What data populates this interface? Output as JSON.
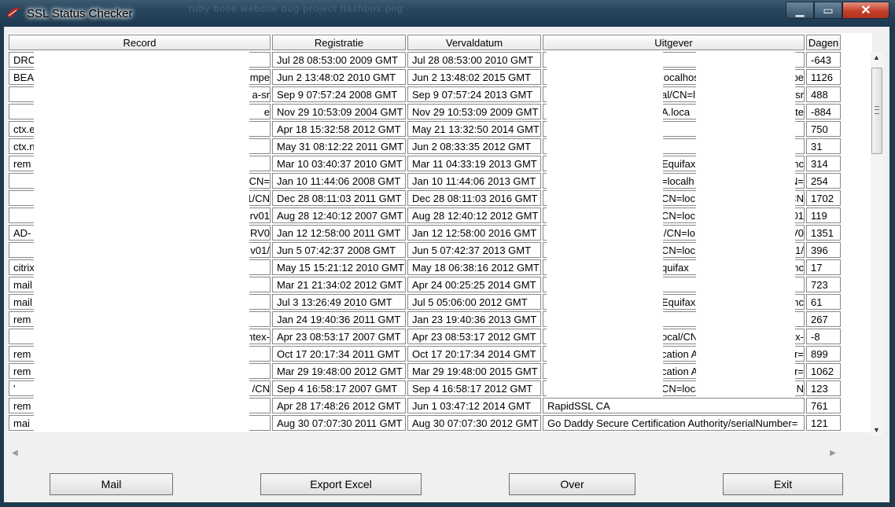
{
  "window": {
    "title": "SSL Status Checker",
    "app_icon": "tk-feather-icon",
    "background_taskbar": "ruby book    website    bug project    flashbox.png"
  },
  "columns": [
    "Record",
    "Registratie",
    "Vervaldatum",
    "Uitgever",
    "Dagen"
  ],
  "rows": [
    {
      "record_left": "DRC",
      "record_right": "",
      "registratie": "Jul 28 08:53:00 2009 GMT",
      "vervaldatum": "Jul 28 08:53:00 2010 GMT",
      "uitgever_left": "",
      "uitgever_mid": "",
      "uitgever_right": "",
      "dagen": "-643"
    },
    {
      "record_left": "BEA",
      "record_right": "mpe",
      "registratie": "Jun  2 13:48:02 2010 GMT",
      "vervaldatum": "Jun  2 13:48:02 2015 GMT",
      "uitgever_left": "",
      "uitgever_mid": "localhos",
      "uitgever_right": "pe",
      "dagen": "1126"
    },
    {
      "record_left": "",
      "record_right": "a-sr",
      "registratie": "Sep  9 07:57:24 2008 GMT",
      "vervaldatum": "Sep  9 07:57:24 2013 GMT",
      "uitgever_left": "",
      "uitgever_mid": "al/CN=l",
      "uitgever_right": "sr",
      "dagen": "488"
    },
    {
      "record_left": "",
      "record_right": "e",
      "registratie": "Nov 29 10:53:09 2004 GMT",
      "vervaldatum": "Nov 29 10:53:09 2009 GMT",
      "uitgever_left": "",
      "uitgever_mid": "A.loca",
      "uitgever_right": "te",
      "dagen": "-884"
    },
    {
      "record_left": "ctx.e",
      "record_right": "",
      "registratie": "Apr 18 15:32:58 2012 GMT",
      "vervaldatum": "May 21 13:32:50 2014 GMT",
      "uitgever_left": "",
      "uitgever_mid": "",
      "uitgever_right": "",
      "dagen": "750"
    },
    {
      "record_left": "ctx.n",
      "record_right": "",
      "registratie": "May 31 08:12:22 2011 GMT",
      "vervaldatum": "Jun  2 08:33:35 2012 GMT",
      "uitgever_left": "",
      "uitgever_mid": "",
      "uitgever_right": "",
      "dagen": "31"
    },
    {
      "record_left": "rem",
      "record_right": "",
      "registratie": "Mar 10 03:40:37 2010 GMT",
      "vervaldatum": "Mar 11 04:33:19 2013 GMT",
      "uitgever_left": "",
      "uitgever_mid": "Equifax",
      "uitgever_right": "hc",
      "dagen": "314"
    },
    {
      "record_left": "",
      "record_right": "/CN=",
      "registratie": "Jan 10 11:44:06 2008 GMT",
      "vervaldatum": "Jan 10 11:44:06 2013 GMT",
      "uitgever_left": "",
      "uitgever_mid": "=localh",
      "uitgever_right": "N=",
      "dagen": "254"
    },
    {
      "record_left": "",
      "record_right": "1/CN",
      "registratie": "Dec 28 08:11:03 2011 GMT",
      "vervaldatum": "Dec 28 08:11:03 2016 GMT",
      "uitgever_left": "",
      "uitgever_mid": "CN=loc",
      "uitgever_right": "CN",
      "dagen": "1702"
    },
    {
      "record_left": "",
      "record_right": "srv01",
      "registratie": "Aug 28 12:40:12 2007 GMT",
      "vervaldatum": "Aug 28 12:40:12 2012 GMT",
      "uitgever_left": "",
      "uitgever_mid": "CN=loc",
      "uitgever_right": "01",
      "dagen": "119"
    },
    {
      "record_left": "AD-",
      "record_right": "RV0",
      "registratie": "Jan 12 12:58:00 2011 GMT",
      "vervaldatum": "Jan 12 12:58:00 2016 GMT",
      "uitgever_left": "",
      "uitgever_mid": "l/CN=lo",
      "uitgever_right": "V0",
      "dagen": "1351"
    },
    {
      "record_left": "",
      "record_right": "v01/",
      "registratie": "Jun  5 07:42:37 2008 GMT",
      "vervaldatum": "Jun  5 07:42:37 2013 GMT",
      "uitgever_left": "",
      "uitgever_mid": "CN=loc",
      "uitgever_right": "1/",
      "dagen": "396"
    },
    {
      "record_left": "citrix",
      "record_right": "",
      "registratie": "May 15 15:21:12 2010 GMT",
      "vervaldatum": "May 18 06:38:16 2012 GMT",
      "uitgever_left": "",
      "uitgever_mid": "quifax",
      "uitgever_right": "hc",
      "dagen": "17"
    },
    {
      "record_left": "mail",
      "record_right": "",
      "registratie": "Mar 21 21:34:02 2012 GMT",
      "vervaldatum": "Apr 24 00:25:25 2014 GMT",
      "uitgever_left": "",
      "uitgever_mid": "",
      "uitgever_right": "",
      "dagen": "723"
    },
    {
      "record_left": "mail",
      "record_right": "",
      "registratie": "Jul  3 13:26:49 2010 GMT",
      "vervaldatum": "Jul  5 05:06:00 2012 GMT",
      "uitgever_left": "",
      "uitgever_mid": "Equifax",
      "uitgever_right": "hc",
      "dagen": "61"
    },
    {
      "record_left": "rem",
      "record_right": "",
      "registratie": "Jan 24 19:40:36 2011 GMT",
      "vervaldatum": "Jan 23 19:40:36 2013 GMT",
      "uitgever_left": "",
      "uitgever_mid": "",
      "uitgever_right": "",
      "dagen": "267"
    },
    {
      "record_left": "",
      "record_right": "ntex-",
      "registratie": "Apr 23 08:53:17 2007 GMT",
      "vervaldatum": "Apr 23 08:53:17 2012 GMT",
      "uitgever_left": "",
      "uitgever_mid": "ocal/CN",
      "uitgever_right": "x-",
      "dagen": "-8"
    },
    {
      "record_left": "rem",
      "record_right": "",
      "registratie": "Oct 17 20:17:34 2011 GMT",
      "vervaldatum": "Oct 17 20:17:34 2014 GMT",
      "uitgever_left": "",
      "uitgever_mid": "cation A",
      "uitgever_right": "er=",
      "dagen": "899"
    },
    {
      "record_left": "rem",
      "record_right": "",
      "registratie": "Mar 29 19:48:00 2012 GMT",
      "vervaldatum": "Mar 29 19:48:00 2015 GMT",
      "uitgever_left": "",
      "uitgever_mid": "cation A",
      "uitgever_right": "er=",
      "dagen": "1062"
    },
    {
      "record_left": "'",
      "record_right": "/CN",
      "registratie": "Sep  4 16:58:17 2007 GMT",
      "vervaldatum": "Sep  4 16:58:17 2012 GMT",
      "uitgever_left": "",
      "uitgever_mid": "CN=loca",
      "uitgever_right": "N",
      "dagen": "123"
    },
    {
      "record_left": "rem",
      "record_right": "",
      "registratie": "Apr 28 17:48:26 2012 GMT",
      "vervaldatum": "Jun  1 03:47:12 2014 GMT",
      "uitgever_left": "RapidSSL CA",
      "uitgever_mid": "",
      "uitgever_right": "",
      "dagen": "761"
    },
    {
      "record_left": "mai",
      "record_right": "",
      "registratie": "Aug 30 07:07:30 2011 GMT",
      "vervaldatum": "Aug 30 07:07:30 2012 GMT",
      "uitgever_left": "Go Daddy Secure Certification Authority/serialNumber=",
      "uitgever_mid": "",
      "uitgever_right": "",
      "dagen": "121"
    }
  ],
  "buttons": {
    "mail": "Mail",
    "export": "Export Excel",
    "over": "Over",
    "exit": "Exit"
  },
  "icons": {
    "minimize": "minimize-icon",
    "maximize": "maximize-icon",
    "close": "close-icon"
  }
}
